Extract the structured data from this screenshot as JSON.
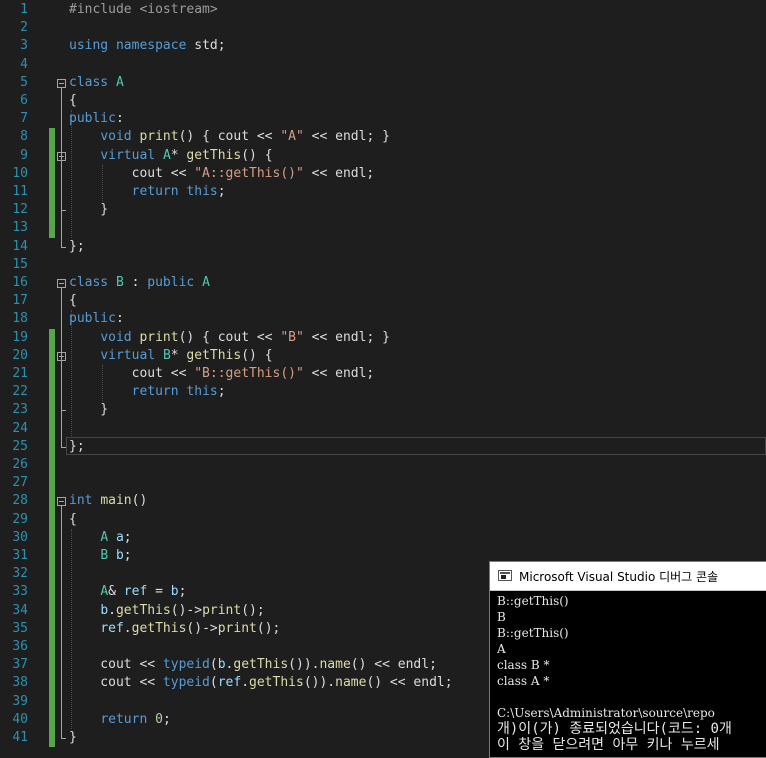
{
  "editor": {
    "line_numbers": [
      "1",
      "2",
      "3",
      "4",
      "5",
      "6",
      "7",
      "8",
      "9",
      "10",
      "11",
      "12",
      "13",
      "14",
      "15",
      "16",
      "17",
      "18",
      "19",
      "20",
      "21",
      "22",
      "23",
      "24",
      "25",
      "26",
      "27",
      "28",
      "29",
      "30",
      "31",
      "32",
      "33",
      "34",
      "35",
      "36",
      "37",
      "38",
      "39",
      "40",
      "41"
    ],
    "lines": [
      [
        {
          "t": "#include <iostream>",
          "c": "pp"
        }
      ],
      [],
      [
        {
          "t": "using",
          "c": "kw"
        },
        {
          "t": " "
        },
        {
          "t": "namespace",
          "c": "kw"
        },
        {
          "t": " std;"
        }
      ],
      [],
      [
        {
          "t": "class",
          "c": "kw"
        },
        {
          "t": " "
        },
        {
          "t": "A",
          "c": "ty"
        }
      ],
      [
        {
          "t": "{"
        }
      ],
      [
        {
          "t": "public",
          "c": "kw"
        },
        {
          "t": ":"
        }
      ],
      [
        {
          "t": "    "
        },
        {
          "t": "void",
          "c": "kw"
        },
        {
          "t": " "
        },
        {
          "t": "print",
          "c": "fn"
        },
        {
          "t": "() { cout << "
        },
        {
          "t": "\"A\"",
          "c": "str"
        },
        {
          "t": " << endl; }"
        }
      ],
      [
        {
          "t": "    "
        },
        {
          "t": "virtual",
          "c": "kw"
        },
        {
          "t": " "
        },
        {
          "t": "A",
          "c": "ty"
        },
        {
          "t": "* "
        },
        {
          "t": "getThis",
          "c": "fn"
        },
        {
          "t": "() {"
        }
      ],
      [
        {
          "t": "        cout << "
        },
        {
          "t": "\"A::getThis()\"",
          "c": "str"
        },
        {
          "t": " << endl;"
        }
      ],
      [
        {
          "t": "        "
        },
        {
          "t": "return",
          "c": "kw"
        },
        {
          "t": " "
        },
        {
          "t": "this",
          "c": "kw"
        },
        {
          "t": ";"
        }
      ],
      [
        {
          "t": "    }"
        }
      ],
      [],
      [
        {
          "t": "};"
        }
      ],
      [],
      [
        {
          "t": "class",
          "c": "kw"
        },
        {
          "t": " "
        },
        {
          "t": "B",
          "c": "ty"
        },
        {
          "t": " : "
        },
        {
          "t": "public",
          "c": "kw"
        },
        {
          "t": " "
        },
        {
          "t": "A",
          "c": "ty"
        }
      ],
      [
        {
          "t": "{"
        }
      ],
      [
        {
          "t": "public",
          "c": "kw"
        },
        {
          "t": ":"
        }
      ],
      [
        {
          "t": "    "
        },
        {
          "t": "void",
          "c": "kw"
        },
        {
          "t": " "
        },
        {
          "t": "print",
          "c": "fn"
        },
        {
          "t": "() { cout << "
        },
        {
          "t": "\"B\"",
          "c": "str"
        },
        {
          "t": " << endl; }"
        }
      ],
      [
        {
          "t": "    "
        },
        {
          "t": "virtual",
          "c": "kw"
        },
        {
          "t": " "
        },
        {
          "t": "B",
          "c": "ty"
        },
        {
          "t": "* "
        },
        {
          "t": "getThis",
          "c": "fn"
        },
        {
          "t": "() {"
        }
      ],
      [
        {
          "t": "        cout << "
        },
        {
          "t": "\"B::getThis()\"",
          "c": "str"
        },
        {
          "t": " << endl;"
        }
      ],
      [
        {
          "t": "        "
        },
        {
          "t": "return",
          "c": "kw"
        },
        {
          "t": " "
        },
        {
          "t": "this",
          "c": "kw"
        },
        {
          "t": ";"
        }
      ],
      [
        {
          "t": "    }"
        }
      ],
      [],
      [
        {
          "t": "};"
        }
      ],
      [],
      [],
      [
        {
          "t": "int",
          "c": "kw"
        },
        {
          "t": " "
        },
        {
          "t": "main",
          "c": "fn"
        },
        {
          "t": "()"
        }
      ],
      [
        {
          "t": "{"
        }
      ],
      [
        {
          "t": "    "
        },
        {
          "t": "A",
          "c": "ty"
        },
        {
          "t": " "
        },
        {
          "t": "a",
          "c": "vr"
        },
        {
          "t": ";"
        }
      ],
      [
        {
          "t": "    "
        },
        {
          "t": "B",
          "c": "ty"
        },
        {
          "t": " "
        },
        {
          "t": "b",
          "c": "vr"
        },
        {
          "t": ";"
        }
      ],
      [],
      [
        {
          "t": "    "
        },
        {
          "t": "A",
          "c": "ty"
        },
        {
          "t": "& "
        },
        {
          "t": "ref",
          "c": "vr"
        },
        {
          "t": " = "
        },
        {
          "t": "b",
          "c": "vr"
        },
        {
          "t": ";"
        }
      ],
      [
        {
          "t": "    "
        },
        {
          "t": "b",
          "c": "vr"
        },
        {
          "t": "."
        },
        {
          "t": "getThis",
          "c": "fn"
        },
        {
          "t": "()->"
        },
        {
          "t": "print",
          "c": "fn"
        },
        {
          "t": "();"
        }
      ],
      [
        {
          "t": "    "
        },
        {
          "t": "ref",
          "c": "vr"
        },
        {
          "t": "."
        },
        {
          "t": "getThis",
          "c": "fn"
        },
        {
          "t": "()->"
        },
        {
          "t": "print",
          "c": "fn"
        },
        {
          "t": "();"
        }
      ],
      [],
      [
        {
          "t": "    cout << "
        },
        {
          "t": "typeid",
          "c": "kw"
        },
        {
          "t": "("
        },
        {
          "t": "b",
          "c": "vr"
        },
        {
          "t": "."
        },
        {
          "t": "getThis",
          "c": "fn"
        },
        {
          "t": "())."
        },
        {
          "t": "name",
          "c": "fn"
        },
        {
          "t": "() << endl;"
        }
      ],
      [
        {
          "t": "    cout << "
        },
        {
          "t": "typeid",
          "c": "kw"
        },
        {
          "t": "("
        },
        {
          "t": "ref",
          "c": "vr"
        },
        {
          "t": "."
        },
        {
          "t": "getThis",
          "c": "fn"
        },
        {
          "t": "())."
        },
        {
          "t": "name",
          "c": "fn"
        },
        {
          "t": "() << endl;"
        }
      ],
      [],
      [
        {
          "t": "    "
        },
        {
          "t": "return",
          "c": "kw"
        },
        {
          "t": " "
        },
        {
          "t": "0",
          "c": "nm"
        },
        {
          "t": ";"
        }
      ],
      [
        {
          "t": "}"
        }
      ]
    ],
    "changed_lines": [
      8,
      9,
      10,
      11,
      12,
      13,
      19,
      20,
      21,
      22,
      23,
      24,
      25,
      26,
      27,
      28,
      29,
      30,
      31,
      32,
      33,
      34,
      35,
      36,
      37,
      38,
      39,
      40,
      41
    ],
    "folded_blocks": [
      {
        "start": 5,
        "end": 14
      },
      {
        "start": 9,
        "end": 12
      },
      {
        "start": 16,
        "end": 25
      },
      {
        "start": 20,
        "end": 23
      },
      {
        "start": 28,
        "end": 41
      }
    ],
    "current_line": 25
  },
  "console": {
    "title": "Microsoft Visual Studio 디버그 콘솔",
    "icon": "console-window-icon",
    "lines": [
      "B::getThis()",
      "B",
      "B::getThis()",
      "A",
      "class B *",
      "class A *",
      "",
      "C:\\Users\\Administrator\\source\\repo",
      "개)이(가) 종료되었습니다(코드: 0개",
      "이 창을 닫으려면 아무 키나 누르세"
    ]
  },
  "colors": {
    "background": "#1e1e1e",
    "line_number": "#2b91af",
    "keyword": "#569cd6",
    "type": "#4ec9b0",
    "string": "#d69d85",
    "function": "#dcdcaa",
    "change_bar": "#57a64a"
  }
}
